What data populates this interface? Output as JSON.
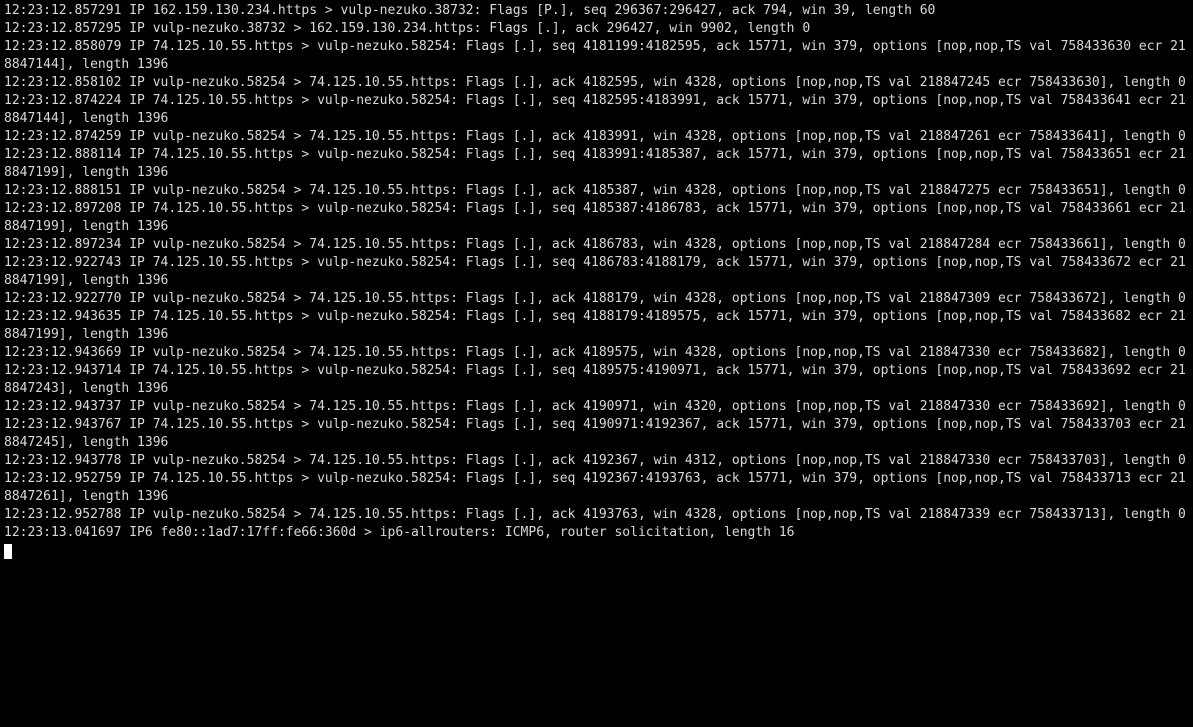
{
  "terminal": {
    "colors": {
      "bg": "#000000",
      "fg": "#d9d9d9",
      "cursor": "#ffffff"
    },
    "lines": [
      "12:23:12.857291 IP 162.159.130.234.https > vulp-nezuko.38732: Flags [P.], seq 296367:296427, ack 794, win 39, length 60",
      "12:23:12.857295 IP vulp-nezuko.38732 > 162.159.130.234.https: Flags [.], ack 296427, win 9902, length 0",
      "12:23:12.858079 IP 74.125.10.55.https > vulp-nezuko.58254: Flags [.], seq 4181199:4182595, ack 15771, win 379, options [nop,nop,TS val 758433630 ecr 218847144], length 1396",
      "12:23:12.858102 IP vulp-nezuko.58254 > 74.125.10.55.https: Flags [.], ack 4182595, win 4328, options [nop,nop,TS val 218847245 ecr 758433630], length 0",
      "12:23:12.874224 IP 74.125.10.55.https > vulp-nezuko.58254: Flags [.], seq 4182595:4183991, ack 15771, win 379, options [nop,nop,TS val 758433641 ecr 218847144], length 1396",
      "12:23:12.874259 IP vulp-nezuko.58254 > 74.125.10.55.https: Flags [.], ack 4183991, win 4328, options [nop,nop,TS val 218847261 ecr 758433641], length 0",
      "12:23:12.888114 IP 74.125.10.55.https > vulp-nezuko.58254: Flags [.], seq 4183991:4185387, ack 15771, win 379, options [nop,nop,TS val 758433651 ecr 218847199], length 1396",
      "12:23:12.888151 IP vulp-nezuko.58254 > 74.125.10.55.https: Flags [.], ack 4185387, win 4328, options [nop,nop,TS val 218847275 ecr 758433651], length 0",
      "12:23:12.897208 IP 74.125.10.55.https > vulp-nezuko.58254: Flags [.], seq 4185387:4186783, ack 15771, win 379, options [nop,nop,TS val 758433661 ecr 218847199], length 1396",
      "12:23:12.897234 IP vulp-nezuko.58254 > 74.125.10.55.https: Flags [.], ack 4186783, win 4328, options [nop,nop,TS val 218847284 ecr 758433661], length 0",
      "12:23:12.922743 IP 74.125.10.55.https > vulp-nezuko.58254: Flags [.], seq 4186783:4188179, ack 15771, win 379, options [nop,nop,TS val 758433672 ecr 218847199], length 1396",
      "12:23:12.922770 IP vulp-nezuko.58254 > 74.125.10.55.https: Flags [.], ack 4188179, win 4328, options [nop,nop,TS val 218847309 ecr 758433672], length 0",
      "12:23:12.943635 IP 74.125.10.55.https > vulp-nezuko.58254: Flags [.], seq 4188179:4189575, ack 15771, win 379, options [nop,nop,TS val 758433682 ecr 218847199], length 1396",
      "12:23:12.943669 IP vulp-nezuko.58254 > 74.125.10.55.https: Flags [.], ack 4189575, win 4328, options [nop,nop,TS val 218847330 ecr 758433682], length 0",
      "12:23:12.943714 IP 74.125.10.55.https > vulp-nezuko.58254: Flags [.], seq 4189575:4190971, ack 15771, win 379, options [nop,nop,TS val 758433692 ecr 218847243], length 1396",
      "12:23:12.943737 IP vulp-nezuko.58254 > 74.125.10.55.https: Flags [.], ack 4190971, win 4320, options [nop,nop,TS val 218847330 ecr 758433692], length 0",
      "12:23:12.943767 IP 74.125.10.55.https > vulp-nezuko.58254: Flags [.], seq 4190971:4192367, ack 15771, win 379, options [nop,nop,TS val 758433703 ecr 218847245], length 1396",
      "12:23:12.943778 IP vulp-nezuko.58254 > 74.125.10.55.https: Flags [.], ack 4192367, win 4312, options [nop,nop,TS val 218847330 ecr 758433703], length 0",
      "12:23:12.952759 IP 74.125.10.55.https > vulp-nezuko.58254: Flags [.], seq 4192367:4193763, ack 15771, win 379, options [nop,nop,TS val 758433713 ecr 218847261], length 1396",
      "12:23:12.952788 IP vulp-nezuko.58254 > 74.125.10.55.https: Flags [.], ack 4193763, win 4328, options [nop,nop,TS val 218847339 ecr 758433713], length 0",
      "12:23:13.041697 IP6 fe80::1ad7:17ff:fe66:360d > ip6-allrouters: ICMP6, router solicitation, length 16"
    ]
  }
}
